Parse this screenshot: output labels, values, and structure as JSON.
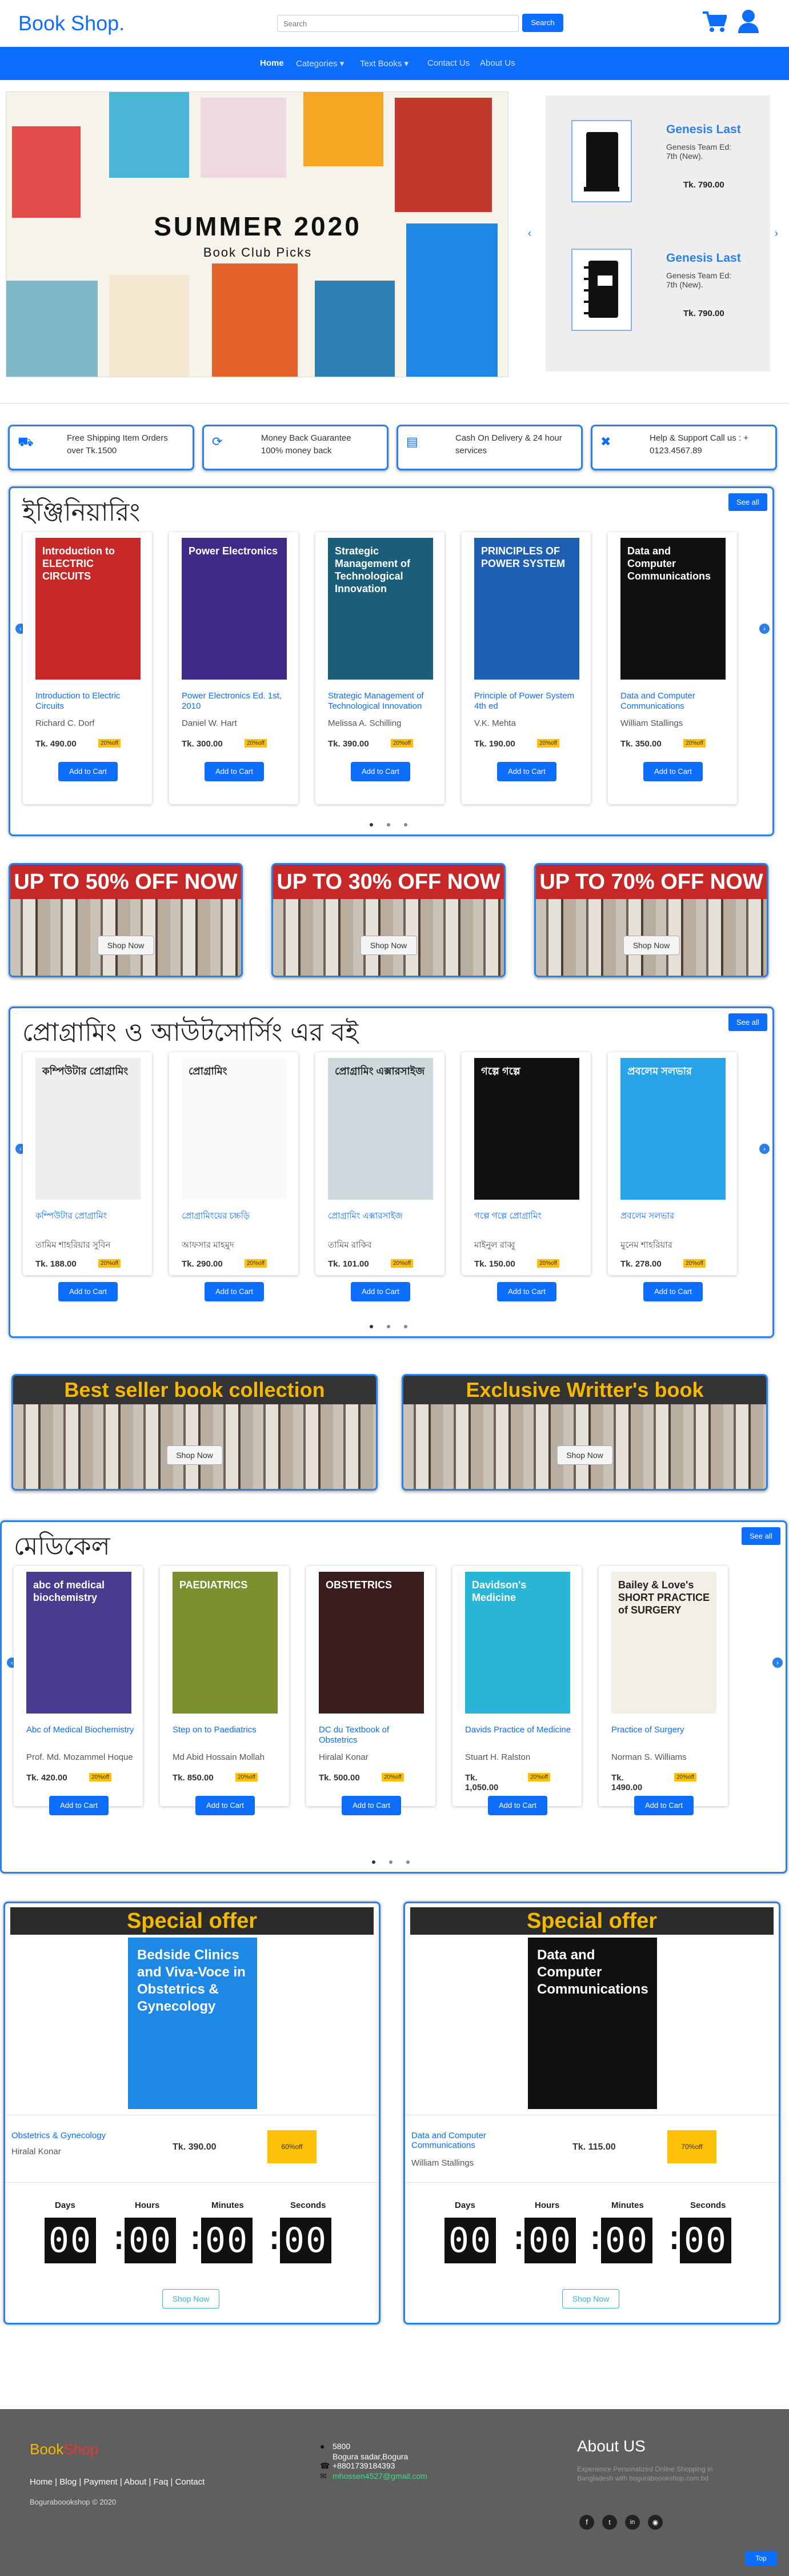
{
  "brand": "Book Shop.",
  "search": {
    "placeholder": "Search",
    "button": "Search"
  },
  "nav": [
    "Home",
    "Categories",
    "Text Books",
    "Contact Us",
    "About Us"
  ],
  "hero": {
    "line1": "SUMMER 2020",
    "line2": "Book Club Picks"
  },
  "side_products": [
    {
      "title": "Genesis Last",
      "desc": "Genesis Team Ed: 7th (New).",
      "price": "Tk. 790.00"
    },
    {
      "title": "Genesis Last",
      "desc": "Genesis Team Ed: 7th (New).",
      "price": "Tk. 790.00"
    }
  ],
  "features": [
    {
      "icon": "truck-icon",
      "text": "Free Shipping Item Orders over Tk.1500"
    },
    {
      "icon": "refresh-icon",
      "text": "Money Back Guarantee 100% money back"
    },
    {
      "icon": "money-icon",
      "text": "Cash On Delivery & 24 hour services"
    },
    {
      "icon": "support-icon",
      "text": "Help & Support Call us : + 0123.4567.89"
    }
  ],
  "see_all": "See all",
  "add_to_cart": "Add to Cart",
  "off_label": "20%off",
  "sections": [
    {
      "title": "ইঞ্জিনিয়ারিং",
      "books": [
        {
          "title": "Introduction to Electric Circuits",
          "author": "Richard C. Dorf",
          "price": "Tk. 490.00",
          "cover_text": "Introduction to ELECTRIC CIRCUITS",
          "cover_bg": "#c62828"
        },
        {
          "title": "Power Electronics Ed. 1st, 2010",
          "author": "Daniel W. Hart",
          "price": "Tk. 300.00",
          "cover_text": "Power Electronics",
          "cover_bg": "#3f2a88"
        },
        {
          "title": "Strategic Management of Technological Innovation",
          "author": "Melissa A. Schilling",
          "price": "Tk. 390.00",
          "cover_text": "Strategic Management of Technological Innovation",
          "cover_bg": "#1b5e7a"
        },
        {
          "title": "Principle of Power System 4th ed",
          "author": "V.K. Mehta",
          "price": "Tk. 190.00",
          "cover_text": "PRINCIPLES OF POWER SYSTEM",
          "cover_bg": "#1e5fb3"
        },
        {
          "title": "Data and Computer Communications",
          "author": "William Stallings",
          "price": "Tk. 350.00",
          "cover_text": "Data and Computer Communications",
          "cover_bg": "#111"
        }
      ]
    },
    {
      "title": "প্রোগ্রামিং ও আউটসোর্সিং এর বই",
      "books": [
        {
          "title": "কম্পিউটার প্রোগ্রামিং",
          "author": "তামিম শাহরিয়ার সুবিন",
          "price": "Tk. 188.00",
          "cover_text": "কম্পিউটার প্রোগ্রামিং",
          "cover_bg": "#eeeeee"
        },
        {
          "title": "প্রোগ্রামিংয়ের চচ্চড়ি",
          "author": "আফসার মাহমুদ",
          "price": "Tk. 290.00",
          "cover_text": "প্রোগ্রামিং",
          "cover_bg": "#fafafa"
        },
        {
          "title": "প্রোগ্রামিং এক্সারসাইজ",
          "author": "তামিম রাকিব",
          "price": "Tk. 101.00",
          "cover_text": "প্রোগ্রামিং এক্সারসাইজ",
          "cover_bg": "#cfd8dc"
        },
        {
          "title": "গল্পে গল্পে প্রোগ্রামিং",
          "author": "মাইনুল রাব্বু",
          "price": "Tk. 150.00",
          "cover_text": "গল্পে গল্পে",
          "cover_bg": "#111"
        },
        {
          "title": "প্রবলেম সলভার",
          "author": "মুনেম শাহরিয়ার",
          "price": "Tk. 278.00",
          "cover_text": "প্রবলেম সলভার",
          "cover_bg": "#29a3e8"
        }
      ]
    },
    {
      "title": "মেডিকেল",
      "books": [
        {
          "title": "Abc of Medical Biochemistry",
          "author": "Prof. Md. Mozammel Hoque",
          "price": "Tk. 420.00",
          "cover_text": "abc of medical biochemistry",
          "cover_bg": "#4a3b8f"
        },
        {
          "title": "Step on to Paediatrics",
          "author": "Md Abid Hossain Mollah",
          "price": "Tk. 850.00",
          "cover_text": "PAEDIATRICS",
          "cover_bg": "#7a8f2e"
        },
        {
          "title": "DC du Textbook of Obstetrics",
          "author": "Hiralal Konar",
          "price": "Tk. 500.00",
          "cover_text": "OBSTETRICS",
          "cover_bg": "#3a1e1e"
        },
        {
          "title": "Davids Practice of Medicine",
          "author": "Stuart H. Ralston",
          "price": "Tk. 1,050.00",
          "cover_text": "Davidson's Medicine",
          "cover_bg": "#29b6d6"
        },
        {
          "title": "Practice of Surgery",
          "author": "Norman S. Williams",
          "price": "Tk. 1490.00",
          "cover_text": "Bailey & Love's SHORT PRACTICE of SURGERY",
          "cover_bg": "#f3efe6"
        }
      ]
    }
  ],
  "promos": [
    "UP TO 50% OFF NOW",
    "UP TO 30% OFF NOW",
    "UP TO 70% OFF NOW"
  ],
  "promos2": [
    "Best seller book collection",
    "Exclusive Writter's book"
  ],
  "shop_now": "Shop Now",
  "special": [
    {
      "heading": "Special offer",
      "title": "Obstetrics & Gynecology",
      "author": "Hiralal Konar",
      "price": "Tk. 390.00",
      "off": "60%off",
      "cover_text": "Bedside Clinics and Viva-Voce in Obstetrics & Gynecology",
      "cover_bg": "#1e88e5"
    },
    {
      "heading": "Special offer",
      "title": "Data and Computer Communications",
      "author": "William Stallings",
      "price": "Tk. 115.00",
      "off": "70%off",
      "cover_text": "Data and Computer Communications",
      "cover_bg": "#111"
    }
  ],
  "timer_labels": [
    "Days",
    "Hours",
    "Minutes",
    "Seconds"
  ],
  "timer_value": "00",
  "footer": {
    "brand1": "Book",
    "brand2": "Shop",
    "links": "Home | Blog | Payment | About | Faq | Contact",
    "copyright": "Boguraboookshop © 2020",
    "address1": "5800",
    "address2": "Bogura sadar,Bogura",
    "phone": "+8801739184393",
    "email": "mhossen4527@gmail.com",
    "about_title": "About US",
    "about_text": "Experience Personalized Online Shopping in Bangladesh with boguraboookshop.com.bd",
    "top": "Top"
  },
  "colors": {
    "primary": "#0d6efd",
    "footer": "#5f5f5f",
    "special_header": "#2b2b2b",
    "special_text": "#f5b800"
  }
}
